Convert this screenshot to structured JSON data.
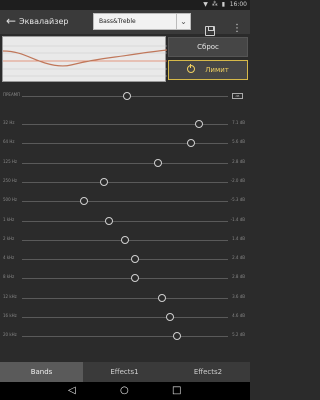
{
  "status": {
    "time": "16:00",
    "icons": "▼ ⁂ ▮"
  },
  "appbar": {
    "title": "Эквалайзер",
    "preset_value": "Bass&Treble",
    "caret": "⌄"
  },
  "buttons": {
    "reset": "Сброс",
    "limit": "Лимит"
  },
  "preamp": {
    "label": "ПРЕАМП",
    "level": 0.51,
    "checkbox": "dB"
  },
  "bands": [
    {
      "label": "32 Hz",
      "db": "7.1 dB",
      "level": 0.86
    },
    {
      "label": "64 Hz",
      "db": "5.6 dB",
      "level": 0.82
    },
    {
      "label": "125 Hz",
      "db": "2.8 dB",
      "level": 0.66
    },
    {
      "label": "250 Hz",
      "db": "-2.0 dB",
      "level": 0.4
    },
    {
      "label": "500 Hz",
      "db": "-5.3 dB",
      "level": 0.3
    },
    {
      "label": "1 kHz",
      "db": "-1.4 dB",
      "level": 0.42
    },
    {
      "label": "2 kHz",
      "db": "1.4 dB",
      "level": 0.5
    },
    {
      "label": "4 kHz",
      "db": "2.4 dB",
      "level": 0.55
    },
    {
      "label": "8 kHz",
      "db": "2.8 dB",
      "level": 0.55
    },
    {
      "label": "12 kHz",
      "db": "3.6 dB",
      "level": 0.68
    },
    {
      "label": "16 kHz",
      "db": "4.6 dB",
      "level": 0.72
    },
    {
      "label": "20 kHz",
      "db": "5.2 dB",
      "level": 0.75
    }
  ],
  "tabs": [
    "Bands",
    "Effects1",
    "Effects2"
  ],
  "nav": {
    "back": "◁",
    "home": "○",
    "recents": "□"
  }
}
